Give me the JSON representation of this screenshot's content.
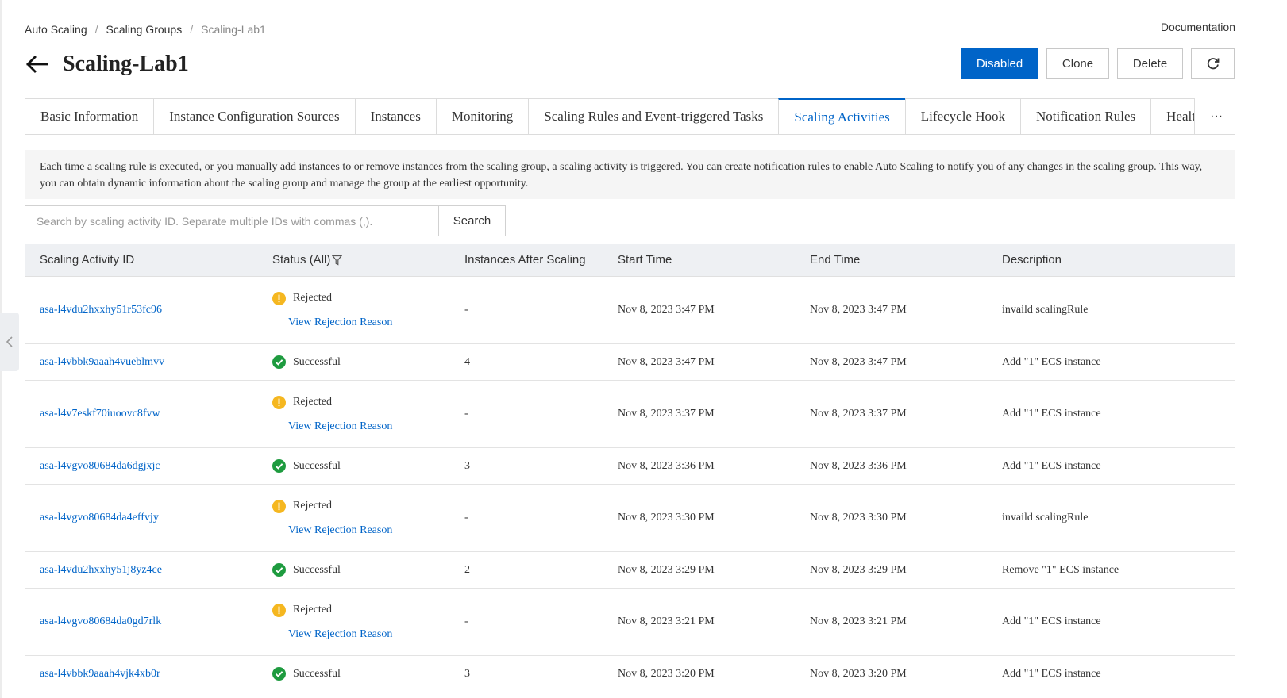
{
  "breadcrumb": {
    "level1": "Auto Scaling",
    "level2": "Scaling Groups",
    "current": "Scaling-Lab1",
    "separator": "/"
  },
  "header": {
    "title": "Scaling-Lab1",
    "documentation": "Documentation"
  },
  "actions": {
    "disabled": "Disabled",
    "clone": "Clone",
    "delete": "Delete"
  },
  "tabs": [
    "Basic Information",
    "Instance Configuration Sources",
    "Instances",
    "Monitoring",
    "Scaling Rules and Event-triggered Tasks",
    "Scaling Activities",
    "Lifecycle Hook",
    "Notification Rules",
    "Healt"
  ],
  "tab_more": "···",
  "info": "Each time a scaling rule is executed, or you manually add instances to or remove instances from the scaling group, a scaling activity is triggered. You can create notification rules to enable Auto Scaling to notify you of any changes in the scaling group. This way, you can obtain dynamic information about the scaling group and manage the group at the earliest opportunity.",
  "search": {
    "placeholder": "Search by scaling activity ID. Separate multiple IDs with commas (,).",
    "button": "Search"
  },
  "table": {
    "headers": [
      "Scaling Activity ID",
      "Status (All)",
      "Instances After Scaling",
      "Start Time",
      "End Time",
      "Description"
    ],
    "rows": [
      {
        "id": "asa-l4vdu2hxxhy51r53fc96",
        "status": "Rejected",
        "reason": "View Rejection Reason",
        "instances": "-",
        "start": "Nov 8, 2023 3:47 PM",
        "end": "Nov 8, 2023 3:47 PM",
        "desc": "invaild scalingRule"
      },
      {
        "id": "asa-l4vbbk9aaah4vueblmvv",
        "status": "Successful",
        "reason": "",
        "instances": "4",
        "start": "Nov 8, 2023 3:47 PM",
        "end": "Nov 8, 2023 3:47 PM",
        "desc": "Add \"1\" ECS instance"
      },
      {
        "id": "asa-l4v7eskf70iuoovc8fvw",
        "status": "Rejected",
        "reason": "View Rejection Reason",
        "instances": "-",
        "start": "Nov 8, 2023 3:37 PM",
        "end": "Nov 8, 2023 3:37 PM",
        "desc": "Add \"1\" ECS instance"
      },
      {
        "id": "asa-l4vgvo80684da6dgjxjc",
        "status": "Successful",
        "reason": "",
        "instances": "3",
        "start": "Nov 8, 2023 3:36 PM",
        "end": "Nov 8, 2023 3:36 PM",
        "desc": "Add \"1\" ECS instance"
      },
      {
        "id": "asa-l4vgvo80684da4effvjy",
        "status": "Rejected",
        "reason": "View Rejection Reason",
        "instances": "-",
        "start": "Nov 8, 2023 3:30 PM",
        "end": "Nov 8, 2023 3:30 PM",
        "desc": "invaild scalingRule"
      },
      {
        "id": "asa-l4vdu2hxxhy51j8yz4ce",
        "status": "Successful",
        "reason": "",
        "instances": "2",
        "start": "Nov 8, 2023 3:29 PM",
        "end": "Nov 8, 2023 3:29 PM",
        "desc": "Remove \"1\" ECS instance"
      },
      {
        "id": "asa-l4vgvo80684da0gd7rlk",
        "status": "Rejected",
        "reason": "View Rejection Reason",
        "instances": "-",
        "start": "Nov 8, 2023 3:21 PM",
        "end": "Nov 8, 2023 3:21 PM",
        "desc": "Add \"1\" ECS instance"
      },
      {
        "id": "asa-l4vbbk9aaah4vjk4xb0r",
        "status": "Successful",
        "reason": "",
        "instances": "3",
        "start": "Nov 8, 2023 3:20 PM",
        "end": "Nov 8, 2023 3:20 PM",
        "desc": "Add \"1\" ECS instance"
      }
    ]
  },
  "colors": {
    "primary": "#0064c8",
    "warning": "#f5b720",
    "success": "#1e9b3f",
    "header_bg": "#eef0f3",
    "info_bg": "#f5f5f5"
  },
  "icons": {
    "back": "arrow-left-icon",
    "refresh": "refresh-icon",
    "filter": "filter-icon",
    "collapse": "chevron-left-icon",
    "rejected": "warning-icon",
    "successful": "check-circle-icon"
  }
}
